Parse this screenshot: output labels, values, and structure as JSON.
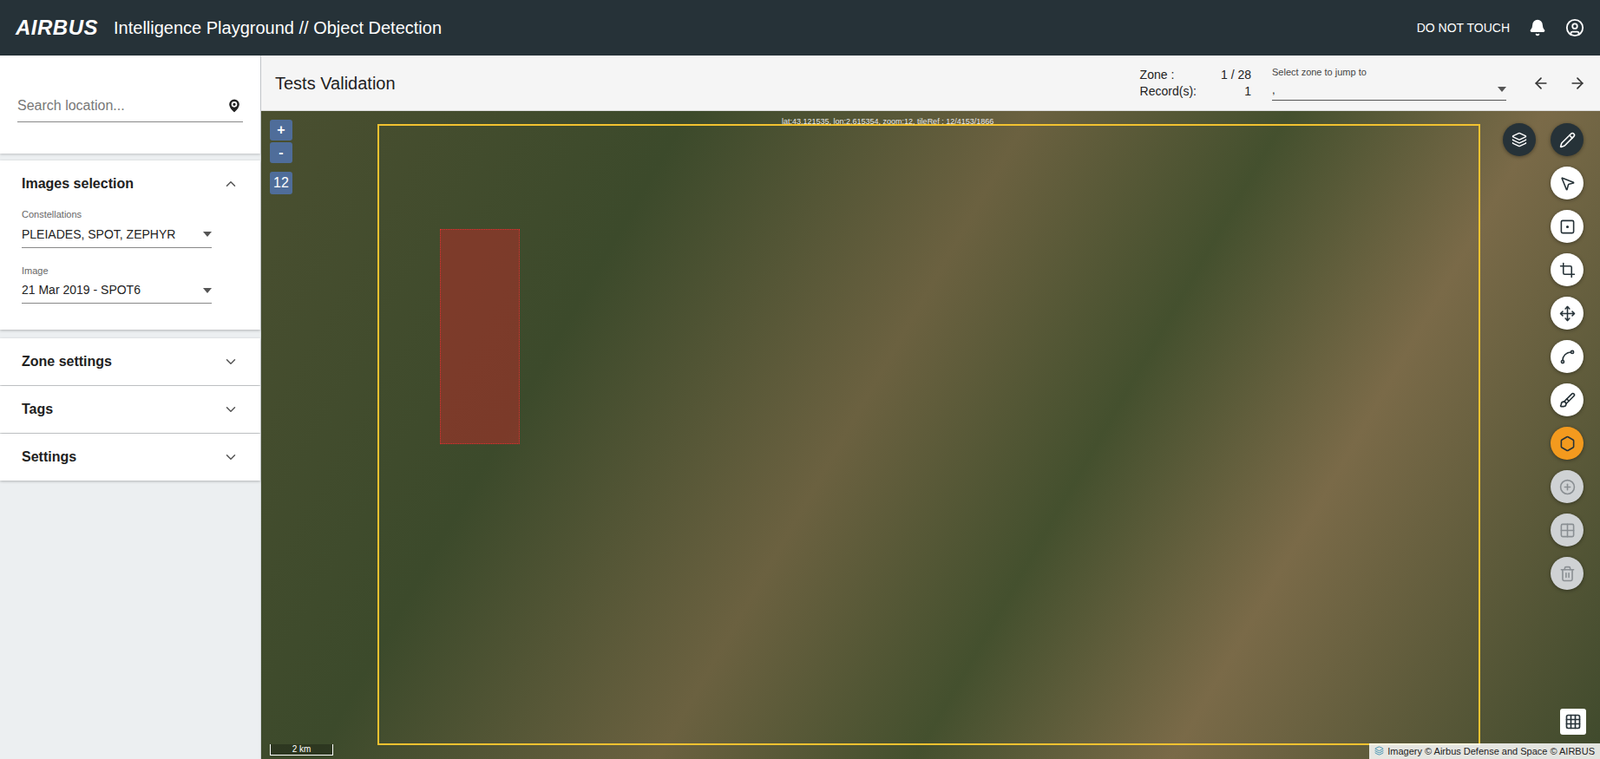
{
  "header": {
    "logo": "AIRBUS",
    "title": "Intelligence Playground // Object Detection",
    "status": "DO NOT TOUCH"
  },
  "sidebar": {
    "search": {
      "placeholder": "Search location..."
    },
    "panels": [
      {
        "title": "Images selection",
        "expanded": true,
        "fields": [
          {
            "label": "Constellations",
            "value": "PLEIADES, SPOT, ZEPHYR"
          },
          {
            "label": "Image",
            "value": "21 Mar 2019 - SPOT6"
          }
        ]
      },
      {
        "title": "Zone settings",
        "expanded": false,
        "fields": []
      },
      {
        "title": "Tags",
        "expanded": false,
        "fields": []
      },
      {
        "title": "Settings",
        "expanded": false,
        "fields": []
      }
    ]
  },
  "toolbar": {
    "title": "Tests Validation",
    "zone_label": "Zone :",
    "zone_value": "1 / 28",
    "records_label": "Record(s):",
    "records_value": "1",
    "jump": {
      "label": "Select zone to jump to",
      "value": ","
    }
  },
  "map": {
    "zoom_in": "+",
    "zoom_out": "-",
    "zoom_level": "12",
    "coords": "lat:43.121535, lon:2.615354, zoom:12, tileRef : 12/4153/1866",
    "scale": "2 km",
    "attribution": "Imagery © Airbus Defense and Space © AIRBUS",
    "edit_toggle": {
      "on": true
    },
    "tools": [
      {
        "kind": "pointer",
        "selected": false,
        "disabled": false
      },
      {
        "kind": "box",
        "selected": false,
        "disabled": false
      },
      {
        "kind": "crop",
        "selected": false,
        "disabled": false
      },
      {
        "kind": "rotate",
        "selected": false,
        "disabled": false
      },
      {
        "kind": "curve",
        "selected": false,
        "disabled": false
      },
      {
        "kind": "brush",
        "selected": false,
        "disabled": false
      },
      {
        "kind": "polygon",
        "selected": true,
        "disabled": false
      },
      {
        "kind": "add",
        "selected": false,
        "disabled": true
      },
      {
        "kind": "grid",
        "selected": false,
        "disabled": true
      },
      {
        "kind": "delete",
        "selected": false,
        "disabled": true
      }
    ]
  }
}
